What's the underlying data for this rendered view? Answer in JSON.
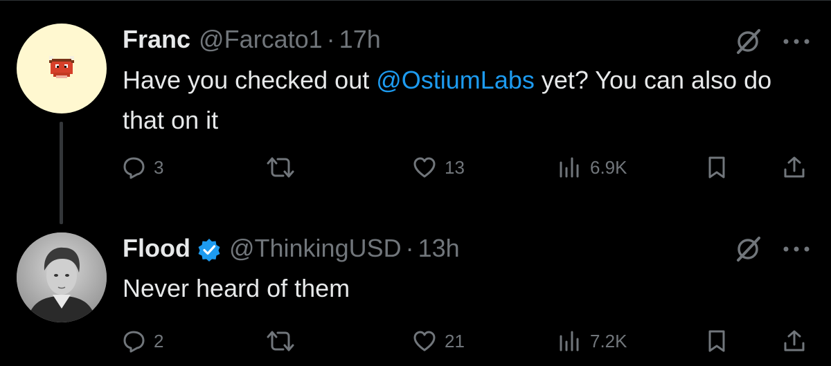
{
  "tweets": [
    {
      "name": "Franc",
      "handle": "@Farcato1",
      "dot": "·",
      "time": "17h",
      "text_before": "Have you checked out ",
      "mention": "@OstiumLabs",
      "text_after": " yet? You can also do that on it",
      "replies": "3",
      "likes": "13",
      "views": "6.9K"
    },
    {
      "name": "Flood",
      "handle": "@ThinkingUSD",
      "dot": "·",
      "time": "13h",
      "text": "Never heard of them",
      "replies": "2",
      "likes": "21",
      "views": "7.2K"
    }
  ],
  "colors": {
    "background": "#000000",
    "text": "#e7e9ea",
    "muted": "#71767b",
    "link": "#1d9bf0",
    "verified": "#1d9bf0"
  },
  "icons": [
    "reply-icon",
    "retweet-icon",
    "like-icon",
    "views-icon",
    "bookmark-icon",
    "share-icon",
    "grok-icon",
    "more-icon",
    "verified-badge-icon"
  ]
}
